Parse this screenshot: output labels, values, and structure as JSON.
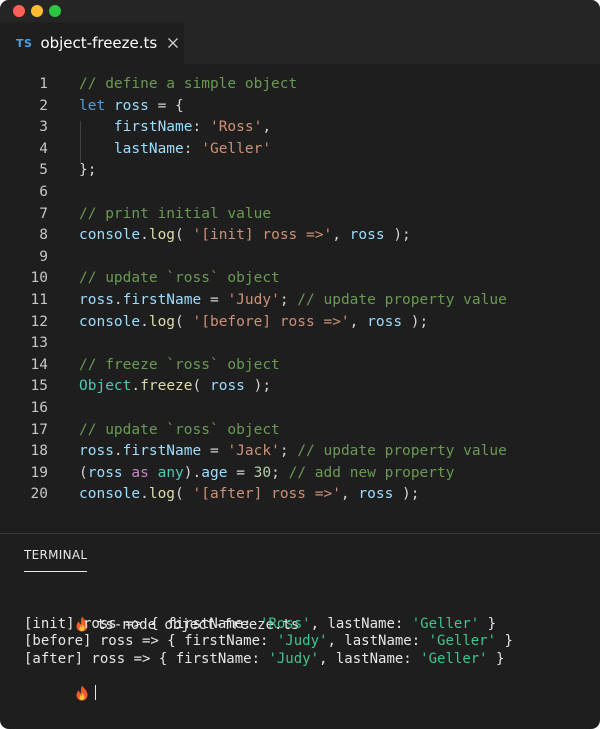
{
  "tab": {
    "lang": "TS",
    "title": "object-freeze.ts"
  },
  "editor": {
    "lines": [
      {
        "num": "1",
        "tokens": [
          {
            "t": "// define a simple object",
            "c": "com"
          }
        ]
      },
      {
        "num": "2",
        "tokens": [
          {
            "t": "let",
            "c": "kw"
          },
          {
            "t": " ",
            "c": "pun"
          },
          {
            "t": "ross",
            "c": "var"
          },
          {
            "t": " = {",
            "c": "pun"
          }
        ]
      },
      {
        "num": "3",
        "tokens": [
          {
            "t": "    ",
            "c": "pun"
          },
          {
            "t": "firstName",
            "c": "var"
          },
          {
            "t": ": ",
            "c": "pun"
          },
          {
            "t": "'Ross'",
            "c": "str"
          },
          {
            "t": ",",
            "c": "pun"
          }
        ]
      },
      {
        "num": "4",
        "tokens": [
          {
            "t": "    ",
            "c": "pun"
          },
          {
            "t": "lastName",
            "c": "var"
          },
          {
            "t": ": ",
            "c": "pun"
          },
          {
            "t": "'Geller'",
            "c": "str"
          }
        ]
      },
      {
        "num": "5",
        "tokens": [
          {
            "t": "};",
            "c": "pun"
          }
        ]
      },
      {
        "num": "6",
        "tokens": []
      },
      {
        "num": "7",
        "tokens": [
          {
            "t": "// print initial value",
            "c": "com"
          }
        ]
      },
      {
        "num": "8",
        "tokens": [
          {
            "t": "console",
            "c": "var"
          },
          {
            "t": ".",
            "c": "pun"
          },
          {
            "t": "log",
            "c": "fn"
          },
          {
            "t": "( ",
            "c": "pun"
          },
          {
            "t": "'[init] ross =>'",
            "c": "str"
          },
          {
            "t": ", ",
            "c": "pun"
          },
          {
            "t": "ross",
            "c": "var"
          },
          {
            "t": " );",
            "c": "pun"
          }
        ]
      },
      {
        "num": "9",
        "tokens": []
      },
      {
        "num": "10",
        "tokens": [
          {
            "t": "// update `ross` object",
            "c": "com"
          }
        ]
      },
      {
        "num": "11",
        "tokens": [
          {
            "t": "ross",
            "c": "var"
          },
          {
            "t": ".",
            "c": "pun"
          },
          {
            "t": "firstName",
            "c": "var"
          },
          {
            "t": " = ",
            "c": "pun"
          },
          {
            "t": "'Judy'",
            "c": "str"
          },
          {
            "t": "; ",
            "c": "pun"
          },
          {
            "t": "// update property value",
            "c": "com"
          }
        ]
      },
      {
        "num": "12",
        "tokens": [
          {
            "t": "console",
            "c": "var"
          },
          {
            "t": ".",
            "c": "pun"
          },
          {
            "t": "log",
            "c": "fn"
          },
          {
            "t": "( ",
            "c": "pun"
          },
          {
            "t": "'[before] ross =>'",
            "c": "str"
          },
          {
            "t": ", ",
            "c": "pun"
          },
          {
            "t": "ross",
            "c": "var"
          },
          {
            "t": " );",
            "c": "pun"
          }
        ]
      },
      {
        "num": "13",
        "tokens": []
      },
      {
        "num": "14",
        "tokens": [
          {
            "t": "// freeze `ross` object",
            "c": "com"
          }
        ]
      },
      {
        "num": "15",
        "tokens": [
          {
            "t": "Object",
            "c": "cls"
          },
          {
            "t": ".",
            "c": "pun"
          },
          {
            "t": "freeze",
            "c": "fn"
          },
          {
            "t": "( ",
            "c": "pun"
          },
          {
            "t": "ross",
            "c": "var"
          },
          {
            "t": " );",
            "c": "pun"
          }
        ]
      },
      {
        "num": "16",
        "tokens": []
      },
      {
        "num": "17",
        "tokens": [
          {
            "t": "// update `ross` object",
            "c": "com"
          }
        ]
      },
      {
        "num": "18",
        "tokens": [
          {
            "t": "ross",
            "c": "var"
          },
          {
            "t": ".",
            "c": "pun"
          },
          {
            "t": "firstName",
            "c": "var"
          },
          {
            "t": " = ",
            "c": "pun"
          },
          {
            "t": "'Jack'",
            "c": "str"
          },
          {
            "t": "; ",
            "c": "pun"
          },
          {
            "t": "// update property value",
            "c": "com"
          }
        ]
      },
      {
        "num": "19",
        "tokens": [
          {
            "t": "(",
            "c": "pun"
          },
          {
            "t": "ross",
            "c": "var"
          },
          {
            "t": " ",
            "c": "pun"
          },
          {
            "t": "as",
            "c": "ctl"
          },
          {
            "t": " ",
            "c": "pun"
          },
          {
            "t": "any",
            "c": "cls"
          },
          {
            "t": ").",
            "c": "pun"
          },
          {
            "t": "age",
            "c": "var"
          },
          {
            "t": " = ",
            "c": "pun"
          },
          {
            "t": "30",
            "c": "num"
          },
          {
            "t": "; ",
            "c": "pun"
          },
          {
            "t": "// add new property",
            "c": "com"
          }
        ]
      },
      {
        "num": "20",
        "tokens": [
          {
            "t": "console",
            "c": "var"
          },
          {
            "t": ".",
            "c": "pun"
          },
          {
            "t": "log",
            "c": "fn"
          },
          {
            "t": "( ",
            "c": "pun"
          },
          {
            "t": "'[after] ross =>'",
            "c": "str"
          },
          {
            "t": ", ",
            "c": "pun"
          },
          {
            "t": "ross",
            "c": "var"
          },
          {
            "t": " );",
            "c": "pun"
          }
        ]
      }
    ]
  },
  "terminal": {
    "tab_label": "TERMINAL",
    "command": " ts-node object-freeze.ts",
    "output": [
      [
        {
          "t": "[init] ross => { firstName: "
        },
        {
          "t": "'Ross'",
          "s": true
        },
        {
          "t": ", lastName: "
        },
        {
          "t": "'Geller'",
          "s": true
        },
        {
          "t": " }"
        }
      ],
      [
        {
          "t": "[before] ross => { firstName: "
        },
        {
          "t": "'Judy'",
          "s": true
        },
        {
          "t": ", lastName: "
        },
        {
          "t": "'Geller'",
          "s": true
        },
        {
          "t": " }"
        }
      ],
      [
        {
          "t": "[after] ross => { firstName: "
        },
        {
          "t": "'Judy'",
          "s": true
        },
        {
          "t": ", lastName: "
        },
        {
          "t": "'Geller'",
          "s": true
        },
        {
          "t": " }"
        }
      ]
    ]
  },
  "icons": {
    "prompt": "flame-icon",
    "close": "close-icon"
  },
  "colors": {
    "string_green": "#3fc58e",
    "tab_lang_blue": "#4aa0e6",
    "window_bg": "#1e1e1e"
  }
}
